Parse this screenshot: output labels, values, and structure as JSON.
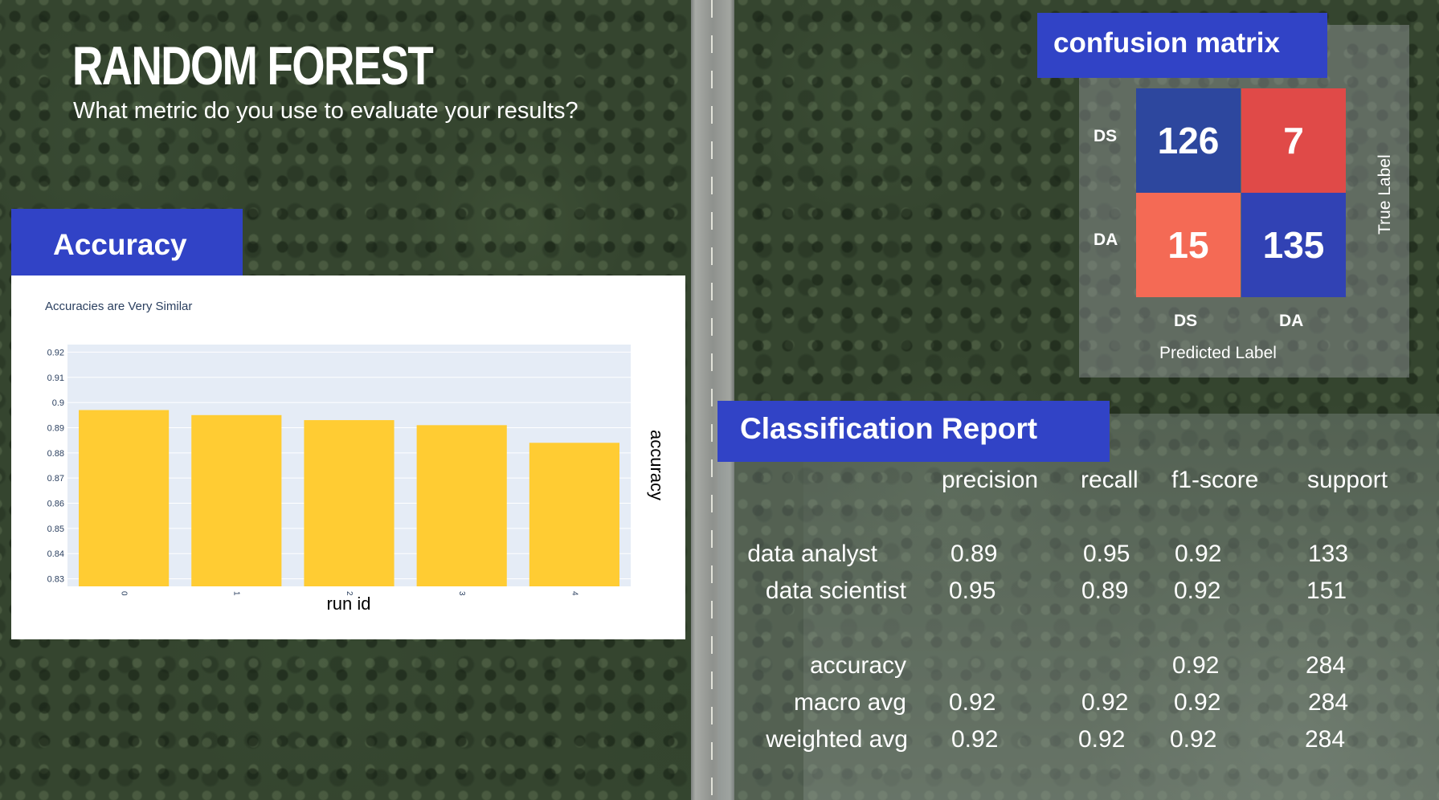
{
  "slide": {
    "title": "RANDOM FOREST",
    "subtitle": "What metric do you use to evaluate your results?"
  },
  "accuracy_section": {
    "heading": "Accuracy"
  },
  "chart_data": {
    "type": "bar",
    "title": "Accuracies are Very Similar",
    "xlabel": "run id",
    "ylabel": "accuracy",
    "categories": [
      "0",
      "1",
      "2",
      "3",
      "4"
    ],
    "values": [
      0.897,
      0.895,
      0.893,
      0.891,
      0.884
    ],
    "ylim": [
      0.827,
      0.923
    ],
    "yticks": [
      "0.92",
      "0.91",
      "0.9",
      "0.89",
      "0.88",
      "0.87",
      "0.86",
      "0.85",
      "0.84",
      "0.83"
    ],
    "ytick_values": [
      0.92,
      0.91,
      0.9,
      0.89,
      0.88,
      0.87,
      0.86,
      0.85,
      0.84,
      0.83
    ],
    "grid": true,
    "bar_color": "#ffcc33",
    "plot_background": "#e5ecf6"
  },
  "confusion_matrix": {
    "heading": "confusion matrix",
    "row_labels": [
      "DS",
      "DA"
    ],
    "col_labels": [
      "DS",
      "DA"
    ],
    "cells": [
      [
        {
          "value": "126",
          "color": "#2d479e"
        },
        {
          "value": "7",
          "color": "#e04a48"
        }
      ],
      [
        {
          "value": "15",
          "color": "#f46a55"
        },
        {
          "value": "135",
          "color": "#3142b4"
        }
      ]
    ],
    "x_axis_label": "Predicted Label",
    "y_axis_label": "True Label"
  },
  "classification_report": {
    "heading": "Classification Report",
    "columns": [
      "precision",
      "recall",
      "f1-score",
      "support"
    ],
    "rows": [
      {
        "label": "data analyst",
        "precision": "0.89",
        "recall": "0.95",
        "f1": "0.92",
        "support": "133"
      },
      {
        "label": "data scientist",
        "precision": "0.95",
        "recall": "0.89",
        "f1": "0.92",
        "support": "151"
      },
      {
        "label": "accuracy",
        "precision": "",
        "recall": "",
        "f1": "0.92",
        "support": "284"
      },
      {
        "label": "macro avg",
        "precision": "0.92",
        "recall": "0.92",
        "f1": "0.92",
        "support": "284"
      },
      {
        "label": "weighted avg",
        "precision": "0.92",
        "recall": "0.92",
        "f1": "0.92",
        "support": "284"
      }
    ]
  },
  "colors": {
    "accent_blue": "#3143c6"
  }
}
